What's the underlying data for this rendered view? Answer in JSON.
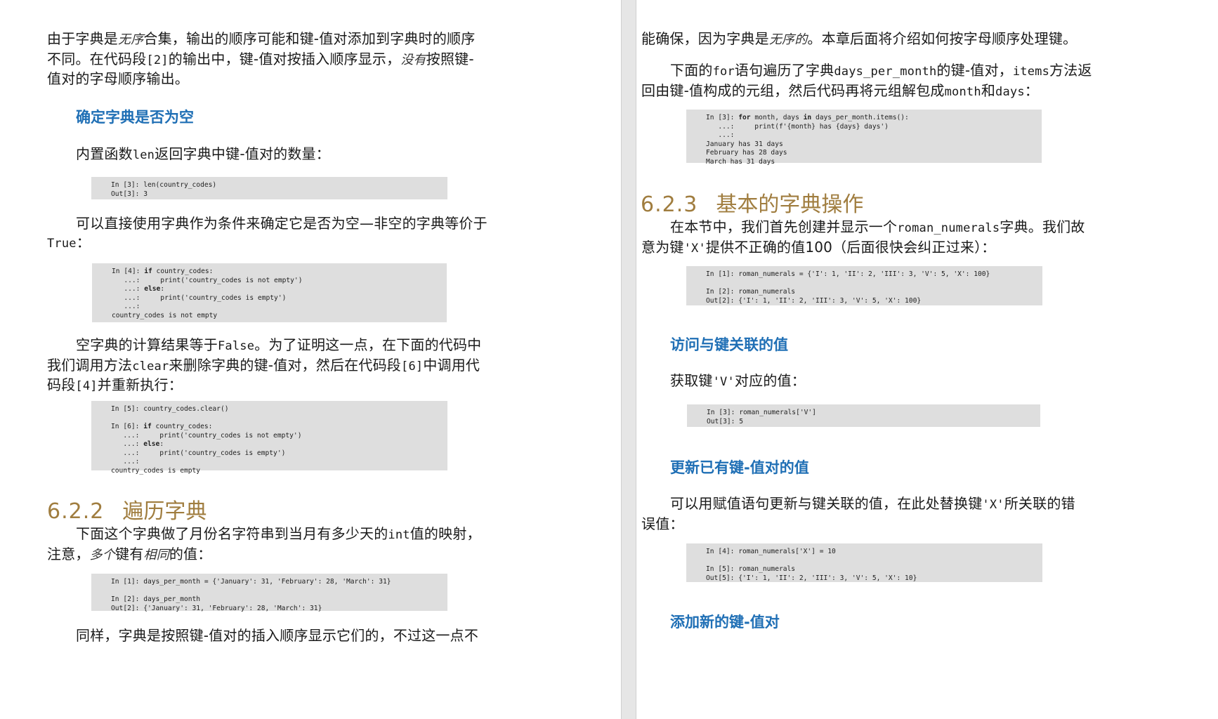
{
  "left": {
    "p1": {
      "l1_a": "由于字典是",
      "l1_it": "无序",
      "l1_b": "合集，输出的顺序可能和键-值对添加到字典时的顺序",
      "l2_a": "不同。在代码段",
      "l2_m": "[2]",
      "l2_b": "的输出中，键-值对按插入顺序显示，",
      "l2_it": "没有",
      "l2_c": "按照键-",
      "l3": "值对的字母顺序输出。"
    },
    "sub_empty": "确定字典是否为空",
    "p2": {
      "a": "内置函数",
      "m": "len",
      "b": "返回字典中键-值对的数量："
    },
    "code3": [
      "In [3]: len(country_codes)",
      "Out[3]: 3"
    ],
    "p3": {
      "l1": "可以直接使用字典作为条件来确定它是否为空—非空的字典等价于",
      "l2_m": "True",
      "l2_b": "："
    },
    "code4": [
      {
        "pre": "In [4]: ",
        "kw": "if",
        "post": " country_codes:"
      },
      {
        "pre": "   ...:     print('country_codes is not empty')",
        "kw": "",
        "post": ""
      },
      {
        "pre": "   ...: ",
        "kw": "else",
        "post": ":"
      },
      {
        "pre": "   ...:     print('country_codes is empty')",
        "kw": "",
        "post": ""
      },
      {
        "pre": "   ...:",
        "kw": "",
        "post": ""
      },
      {
        "pre": "country_codes is not empty",
        "kw": "",
        "post": ""
      }
    ],
    "p4": {
      "l1_a": "空字典的计算结果等于",
      "l1_m": "False",
      "l1_b": "。为了证明这一点，在下面的代码中",
      "l2_a": "我们调用方法",
      "l2_m": "clear",
      "l2_b": "来删除字典的键-值对，然后在代码段",
      "l2_m2": "[6]",
      "l2_c": "中调用代",
      "l3_a": "码段",
      "l3_m": "[4]",
      "l3_b": "并重新执行："
    },
    "code56": [
      {
        "pre": "In [5]: country_codes.clear()",
        "kw": "",
        "post": ""
      },
      {
        "pre": "",
        "kw": "",
        "post": ""
      },
      {
        "pre": "In [6]: ",
        "kw": "if",
        "post": " country_codes:"
      },
      {
        "pre": "   ...:     print('country_codes is not empty')",
        "kw": "",
        "post": ""
      },
      {
        "pre": "   ...: ",
        "kw": "else",
        "post": ":"
      },
      {
        "pre": "   ...:     print('country_codes is empty')",
        "kw": "",
        "post": ""
      },
      {
        "pre": "   ...:",
        "kw": "",
        "post": ""
      },
      {
        "pre": "country_codes is empty",
        "kw": "",
        "post": ""
      }
    ],
    "sec622": {
      "num": "6.2.2",
      "title": "遍历字典"
    },
    "p5": {
      "l1_a": "下面这个字典做了月份名字符串到当月有多少天的",
      "l1_m": "int",
      "l1_b": "值的映射，",
      "l2_a": "注意，",
      "l2_it": "多个",
      "l2_b": "键有",
      "l2_it2": "相同",
      "l2_c": "的值："
    },
    "code12": [
      "In [1]: days_per_month = {'January': 31, 'February': 28, 'March': 31}",
      "",
      "In [2]: days_per_month",
      "Out[2]: {'January': 31, 'February': 28, 'March': 31}"
    ],
    "p6": "同样，字典是按照键-值对的插入顺序显示它们的，不过这一点不"
  },
  "right": {
    "p1": {
      "a": "能确保，因为字典是",
      "it": "无序的",
      "b": "。本章后面将介绍如何按字母顺序处理键。"
    },
    "p2": {
      "l1_a": "下面的",
      "l1_m": "for",
      "l1_b": "语句遍历了字典",
      "l1_m2": "days_per_month",
      "l1_c": "的键-值对，",
      "l1_m3": "items",
      "l1_d": "方法返",
      "l2_a": "回由键-值构成的元组，然后代码再将元组解包成",
      "l2_m": "month",
      "l2_b": "和",
      "l2_m2": "days",
      "l2_c": "："
    },
    "code3": [
      {
        "pre": "In [3]: ",
        "kw": "for",
        "mid": " month, days ",
        "kw2": "in",
        "post": " days_per_month.items():"
      },
      {
        "pre": "   ...:     print(f'{month} has {days} days')",
        "kw": "",
        "mid": "",
        "kw2": "",
        "post": ""
      },
      {
        "pre": "   ...:",
        "kw": "",
        "mid": "",
        "kw2": "",
        "post": ""
      },
      {
        "pre": "January has 31 days",
        "kw": "",
        "mid": "",
        "kw2": "",
        "post": ""
      },
      {
        "pre": "February has 28 days",
        "kw": "",
        "mid": "",
        "kw2": "",
        "post": ""
      },
      {
        "pre": "March has 31 days",
        "kw": "",
        "mid": "",
        "kw2": "",
        "post": ""
      }
    ],
    "sec623": {
      "num": "6.2.3",
      "title": "基本的字典操作"
    },
    "p3": {
      "l1_a": "在本节中，我们首先创建并显示一个",
      "l1_m": "roman_numerals",
      "l1_b": "字典。我们故",
      "l2_a": "意为键",
      "l2_m": "'X'",
      "l2_b": "提供不正确的值100（后面很快会纠正过来）："
    },
    "code12": [
      "In [1]: roman_numerals = {'I': 1, 'II': 2, 'III': 3, 'V': 5, 'X': 100}",
      "",
      "In [2]: roman_numerals",
      "Out[2]: {'I': 1, 'II': 2, 'III': 3, 'V': 5, 'X': 100}"
    ],
    "sub_access": "访问与键关联的值",
    "p4": {
      "a": "获取键",
      "m": "'V'",
      "b": "对应的值："
    },
    "code3b": [
      "In [3]: roman_numerals['V']",
      "Out[3]: 5"
    ],
    "sub_update": "更新已有键-值对的值",
    "p5": {
      "l1_a": "可以用赋值语句更新与键关联的值，在此处替换键",
      "l1_m": "'X'",
      "l1_b": "所关联的错",
      "l2": "误值："
    },
    "code45": [
      "In [4]: roman_numerals['X'] = 10",
      "",
      "In [5]: roman_numerals",
      "Out[5]: {'I': 1, 'II': 2, 'III': 3, 'V': 5, 'X': 10}"
    ],
    "sub_add": "添加新的键-值对"
  }
}
